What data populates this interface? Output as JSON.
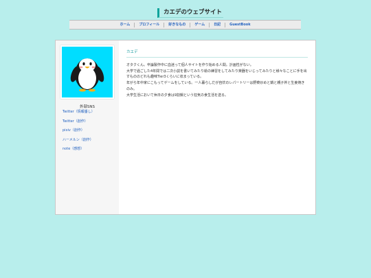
{
  "site": {
    "title": "カエデのウェブサイト"
  },
  "nav": [
    "ホーム",
    "プロフィール",
    "好きなもの",
    "ゲーム",
    "日記",
    "GuestBook"
  ],
  "sidebar": {
    "avatar_icon": "penguin-icon",
    "avatar_bg": "#00ddff",
    "sns_heading": "外部SNS",
    "sns_links": [
      "Twitter（情報垂し）",
      "Twitter（創作）",
      "pixiv（創作）",
      "ハーメルン（創作）",
      "note（感想）"
    ]
  },
  "main": {
    "title": "カエデ",
    "bio": [
      "オタクくん。卒論製作中に血迷って個人サイトを作り始める人間。計画性がない。",
      "大学で過ごした4年間では二次小説を書いてみたり絵の練習をしてみたり楽器をいじってみたりと様々なことに手を出すもののどれも趣味Tier3くらいに収まっている。",
      "年がら年中家にこもってゲームをしている。一人暮らしだが自炊のレパートリーは野菜炒めと鍋と親子丼と生姜焼きのみ。",
      "大学生活において休日の夕食は9割鍋という狂気の食生活を送る。"
    ]
  }
}
